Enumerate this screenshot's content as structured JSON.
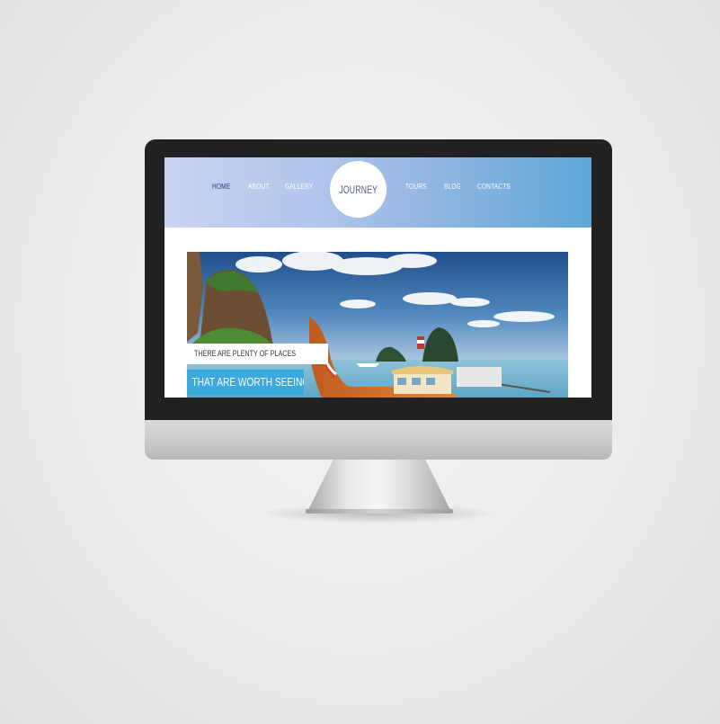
{
  "site": {
    "logo": "JOURNEY",
    "nav_left": [
      {
        "label": "HOME",
        "active": true
      },
      {
        "label": "ABOUT",
        "active": false
      },
      {
        "label": "GALLERY",
        "active": false
      }
    ],
    "nav_right": [
      {
        "label": "TOURS",
        "active": false
      },
      {
        "label": "BLOG",
        "active": false
      },
      {
        "label": "CONTACTS",
        "active": false
      }
    ]
  },
  "hero": {
    "caption_small": "THERE ARE PLENTY OF PLACES",
    "caption_large": "THAT ARE WORTH SEEING"
  },
  "colors": {
    "accent": "#3aa9df",
    "active_nav": "#2d3f7a",
    "bezel": "#222122"
  },
  "icons": {
    "logo": "journey-logo-icon"
  }
}
